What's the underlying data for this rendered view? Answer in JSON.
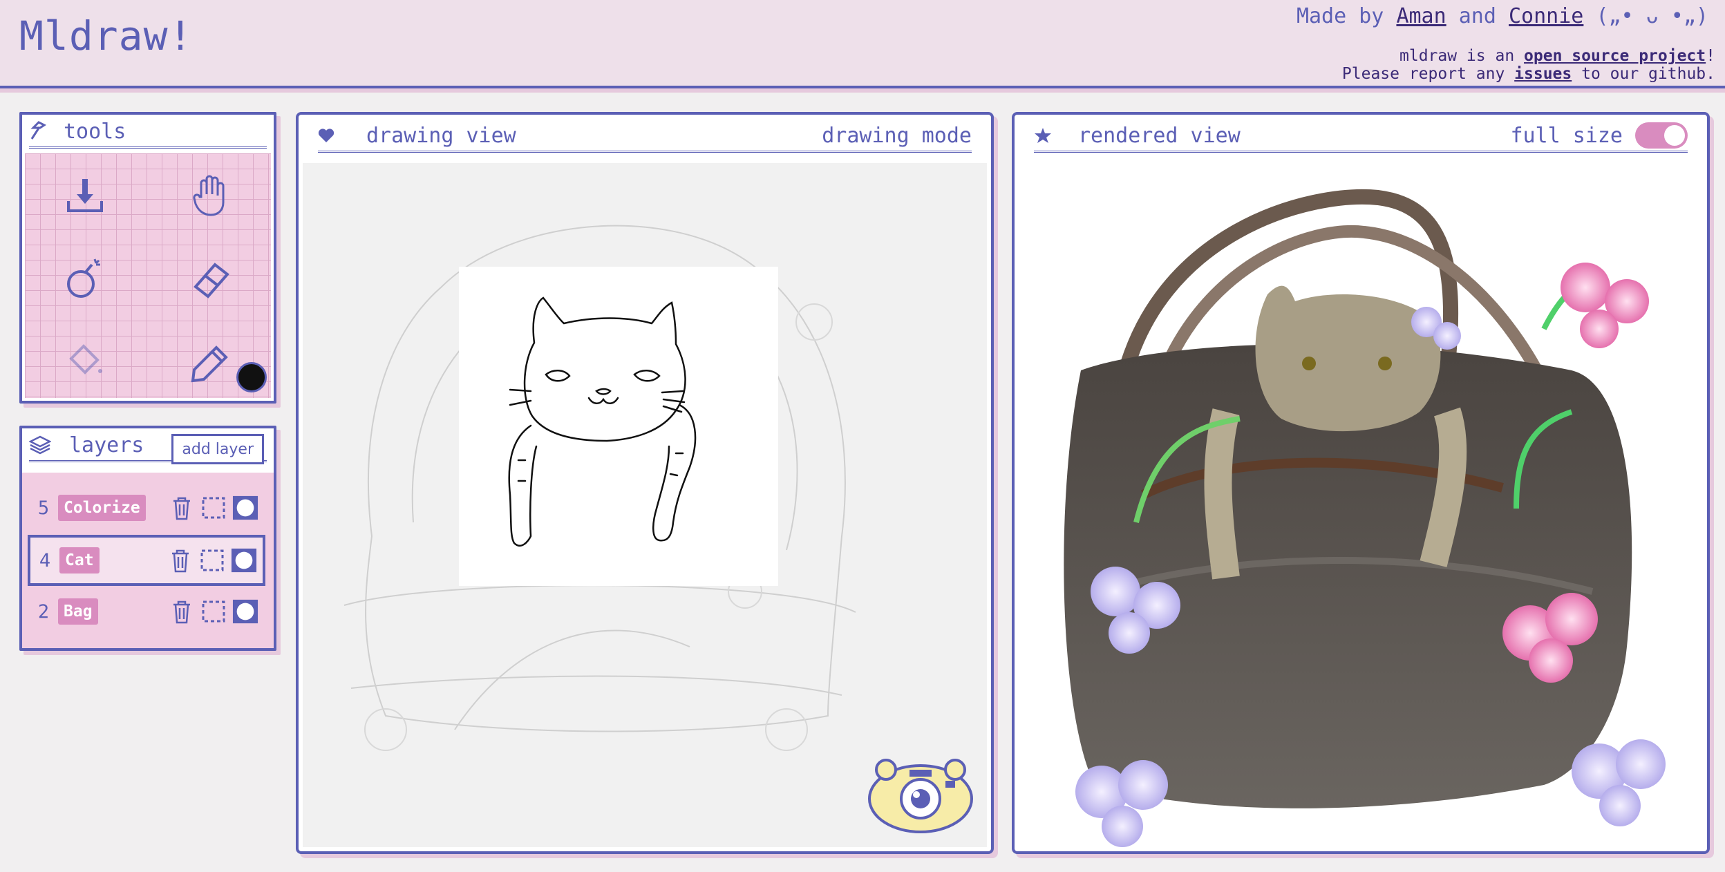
{
  "header": {
    "title": "Mldraw!",
    "credits_prefix": "Made by",
    "author1": "Aman",
    "and": "and",
    "author2": "Connie",
    "emoticon": "(„• ᴗ •„)",
    "line1_prefix": "mldraw is an",
    "line1_link": "open source project",
    "line1_suffix": "!",
    "line2_prefix": "Please report any",
    "line2_link": "issues",
    "line2_suffix": "to our github."
  },
  "tools": {
    "title": "tools",
    "items": [
      "download-icon",
      "hand-icon",
      "bomb-icon",
      "eraser-icon",
      "fill-bucket-icon",
      "pencil-icon"
    ],
    "current_color": "#111111"
  },
  "layers": {
    "title": "layers",
    "add_label": "add layer",
    "rows": [
      {
        "num": "5",
        "name": "Colorize"
      },
      {
        "num": "4",
        "name": "Cat"
      },
      {
        "num": "2",
        "name": "Bag"
      }
    ],
    "selected": "Cat"
  },
  "drawing": {
    "title": "drawing view",
    "mode": "drawing mode"
  },
  "rendered": {
    "title": "rendered view",
    "toggle_label": "full size",
    "toggle_on": true
  },
  "colors": {
    "accent": "#5b5fb5",
    "pink": "#d98cbf",
    "pink_light": "#f2cde2",
    "header_bg": "#eee0ea"
  }
}
